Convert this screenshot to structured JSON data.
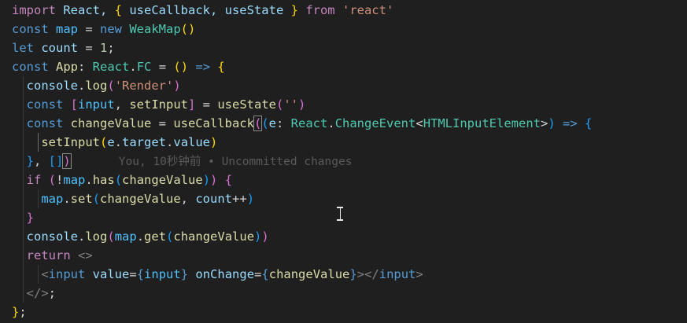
{
  "editor": {
    "lines": [
      [
        {
          "t": "import",
          "c": "kw-ctrl"
        },
        {
          "t": " React, ",
          "c": "var"
        },
        {
          "t": "{",
          "c": "br1"
        },
        {
          "t": " useCallback, useState ",
          "c": "var"
        },
        {
          "t": "}",
          "c": "br1"
        },
        {
          "t": " from ",
          "c": "kw-ctrl"
        },
        {
          "t": "'react'",
          "c": "str"
        }
      ],
      [
        {
          "t": "const ",
          "c": "kw"
        },
        {
          "t": "map",
          "c": "const"
        },
        {
          "t": " = ",
          "c": "op"
        },
        {
          "t": "new ",
          "c": "kw"
        },
        {
          "t": "WeakMap",
          "c": "type"
        },
        {
          "t": "()",
          "c": "br1"
        }
      ],
      [
        {
          "t": "let ",
          "c": "kw"
        },
        {
          "t": "count",
          "c": "var"
        },
        {
          "t": " = ",
          "c": "op"
        },
        {
          "t": "1",
          "c": "num"
        },
        {
          "t": ";",
          "c": "op"
        }
      ],
      [
        {
          "t": "const ",
          "c": "kw"
        },
        {
          "t": "App",
          "c": "fn"
        },
        {
          "t": ": ",
          "c": "op"
        },
        {
          "t": "React",
          "c": "type"
        },
        {
          "t": ".",
          "c": "op"
        },
        {
          "t": "FC",
          "c": "type"
        },
        {
          "t": " = ",
          "c": "op"
        },
        {
          "t": "()",
          "c": "br1"
        },
        {
          "t": " => ",
          "c": "kw"
        },
        {
          "t": "{",
          "c": "br1"
        }
      ],
      [
        {
          "t": "  console",
          "c": "var"
        },
        {
          "t": ".",
          "c": "op"
        },
        {
          "t": "log",
          "c": "fn"
        },
        {
          "t": "(",
          "c": "br2"
        },
        {
          "t": "'Render'",
          "c": "str"
        },
        {
          "t": ")",
          "c": "br2"
        }
      ],
      [
        {
          "t": "  const ",
          "c": "kw"
        },
        {
          "t": "[",
          "c": "br2"
        },
        {
          "t": "input",
          "c": "const"
        },
        {
          "t": ", ",
          "c": "op"
        },
        {
          "t": "setInput",
          "c": "fn"
        },
        {
          "t": "]",
          "c": "br2"
        },
        {
          "t": " = ",
          "c": "op"
        },
        {
          "t": "useState",
          "c": "fn"
        },
        {
          "t": "(",
          "c": "br2"
        },
        {
          "t": "''",
          "c": "str"
        },
        {
          "t": ")",
          "c": "br2"
        }
      ],
      [
        {
          "t": "  const ",
          "c": "kw"
        },
        {
          "t": "changeValue",
          "c": "fn"
        },
        {
          "t": " = ",
          "c": "op"
        },
        {
          "t": "useCallback",
          "c": "fn"
        },
        {
          "t": "(",
          "c": "br2",
          "m": true
        },
        {
          "t": "(",
          "c": "br3"
        },
        {
          "t": "e",
          "c": "var"
        },
        {
          "t": ": ",
          "c": "op"
        },
        {
          "t": "React",
          "c": "type"
        },
        {
          "t": ".",
          "c": "op"
        },
        {
          "t": "ChangeEvent",
          "c": "type"
        },
        {
          "t": "<",
          "c": "op"
        },
        {
          "t": "HTMLInputElement",
          "c": "type"
        },
        {
          "t": ">",
          "c": "op"
        },
        {
          "t": ")",
          "c": "br3"
        },
        {
          "t": " => ",
          "c": "kw"
        },
        {
          "t": "{",
          "c": "br3"
        }
      ],
      [
        {
          "t": "    setInput",
          "c": "fn"
        },
        {
          "t": "(",
          "c": "br1"
        },
        {
          "t": "e",
          "c": "var"
        },
        {
          "t": ".",
          "c": "op"
        },
        {
          "t": "target",
          "c": "var"
        },
        {
          "t": ".",
          "c": "op"
        },
        {
          "t": "value",
          "c": "var"
        },
        {
          "t": ")",
          "c": "br1"
        }
      ],
      [
        {
          "t": "  }",
          "c": "br3"
        },
        {
          "t": ", ",
          "c": "op"
        },
        {
          "t": "[]",
          "c": "br3"
        },
        {
          "t": ")",
          "c": "br2",
          "m": true
        },
        {
          "t": "       You, 10秒钟前 • Uncommitted changes",
          "c": "blame"
        }
      ],
      [
        {
          "t": "  if ",
          "c": "kw-ctrl"
        },
        {
          "t": "(",
          "c": "br2"
        },
        {
          "t": "!",
          "c": "op"
        },
        {
          "t": "map",
          "c": "const"
        },
        {
          "t": ".",
          "c": "op"
        },
        {
          "t": "has",
          "c": "fn"
        },
        {
          "t": "(",
          "c": "br3"
        },
        {
          "t": "changeValue",
          "c": "fn"
        },
        {
          "t": ")",
          "c": "br3"
        },
        {
          "t": ")",
          "c": "br2"
        },
        {
          "t": " {",
          "c": "br2"
        }
      ],
      [
        {
          "t": "    map",
          "c": "const"
        },
        {
          "t": ".",
          "c": "op"
        },
        {
          "t": "set",
          "c": "fn"
        },
        {
          "t": "(",
          "c": "br3"
        },
        {
          "t": "changeValue",
          "c": "fn"
        },
        {
          "t": ", ",
          "c": "op"
        },
        {
          "t": "count",
          "c": "var"
        },
        {
          "t": "++",
          "c": "op"
        },
        {
          "t": ")",
          "c": "br3"
        }
      ],
      [
        {
          "t": "  }",
          "c": "br2"
        }
      ],
      [
        {
          "t": "  console",
          "c": "var"
        },
        {
          "t": ".",
          "c": "op"
        },
        {
          "t": "log",
          "c": "fn"
        },
        {
          "t": "(",
          "c": "br2"
        },
        {
          "t": "map",
          "c": "const"
        },
        {
          "t": ".",
          "c": "op"
        },
        {
          "t": "get",
          "c": "fn"
        },
        {
          "t": "(",
          "c": "br3"
        },
        {
          "t": "changeValue",
          "c": "fn"
        },
        {
          "t": ")",
          "c": "br3"
        },
        {
          "t": ")",
          "c": "br2"
        }
      ],
      [
        {
          "t": "  return ",
          "c": "kw-ctrl"
        },
        {
          "t": "<>",
          "c": "tag"
        }
      ],
      [
        {
          "t": "    <",
          "c": "tag"
        },
        {
          "t": "input ",
          "c": "kw"
        },
        {
          "t": "value",
          "c": "var"
        },
        {
          "t": "=",
          "c": "op"
        },
        {
          "t": "{",
          "c": "kw"
        },
        {
          "t": "input",
          "c": "const"
        },
        {
          "t": "}",
          "c": "kw"
        },
        {
          "t": " onChange",
          "c": "var"
        },
        {
          "t": "=",
          "c": "op"
        },
        {
          "t": "{",
          "c": "kw"
        },
        {
          "t": "changeValue",
          "c": "fn"
        },
        {
          "t": "}",
          "c": "kw"
        },
        {
          "t": "></",
          "c": "tag"
        },
        {
          "t": "input",
          "c": "kw"
        },
        {
          "t": ">",
          "c": "tag"
        }
      ],
      [
        {
          "t": "  </>",
          "c": "tag"
        },
        {
          "t": ";",
          "c": "op"
        }
      ],
      [
        {
          "t": "}",
          "c": "br1"
        },
        {
          "t": ";",
          "c": "op"
        }
      ]
    ]
  }
}
